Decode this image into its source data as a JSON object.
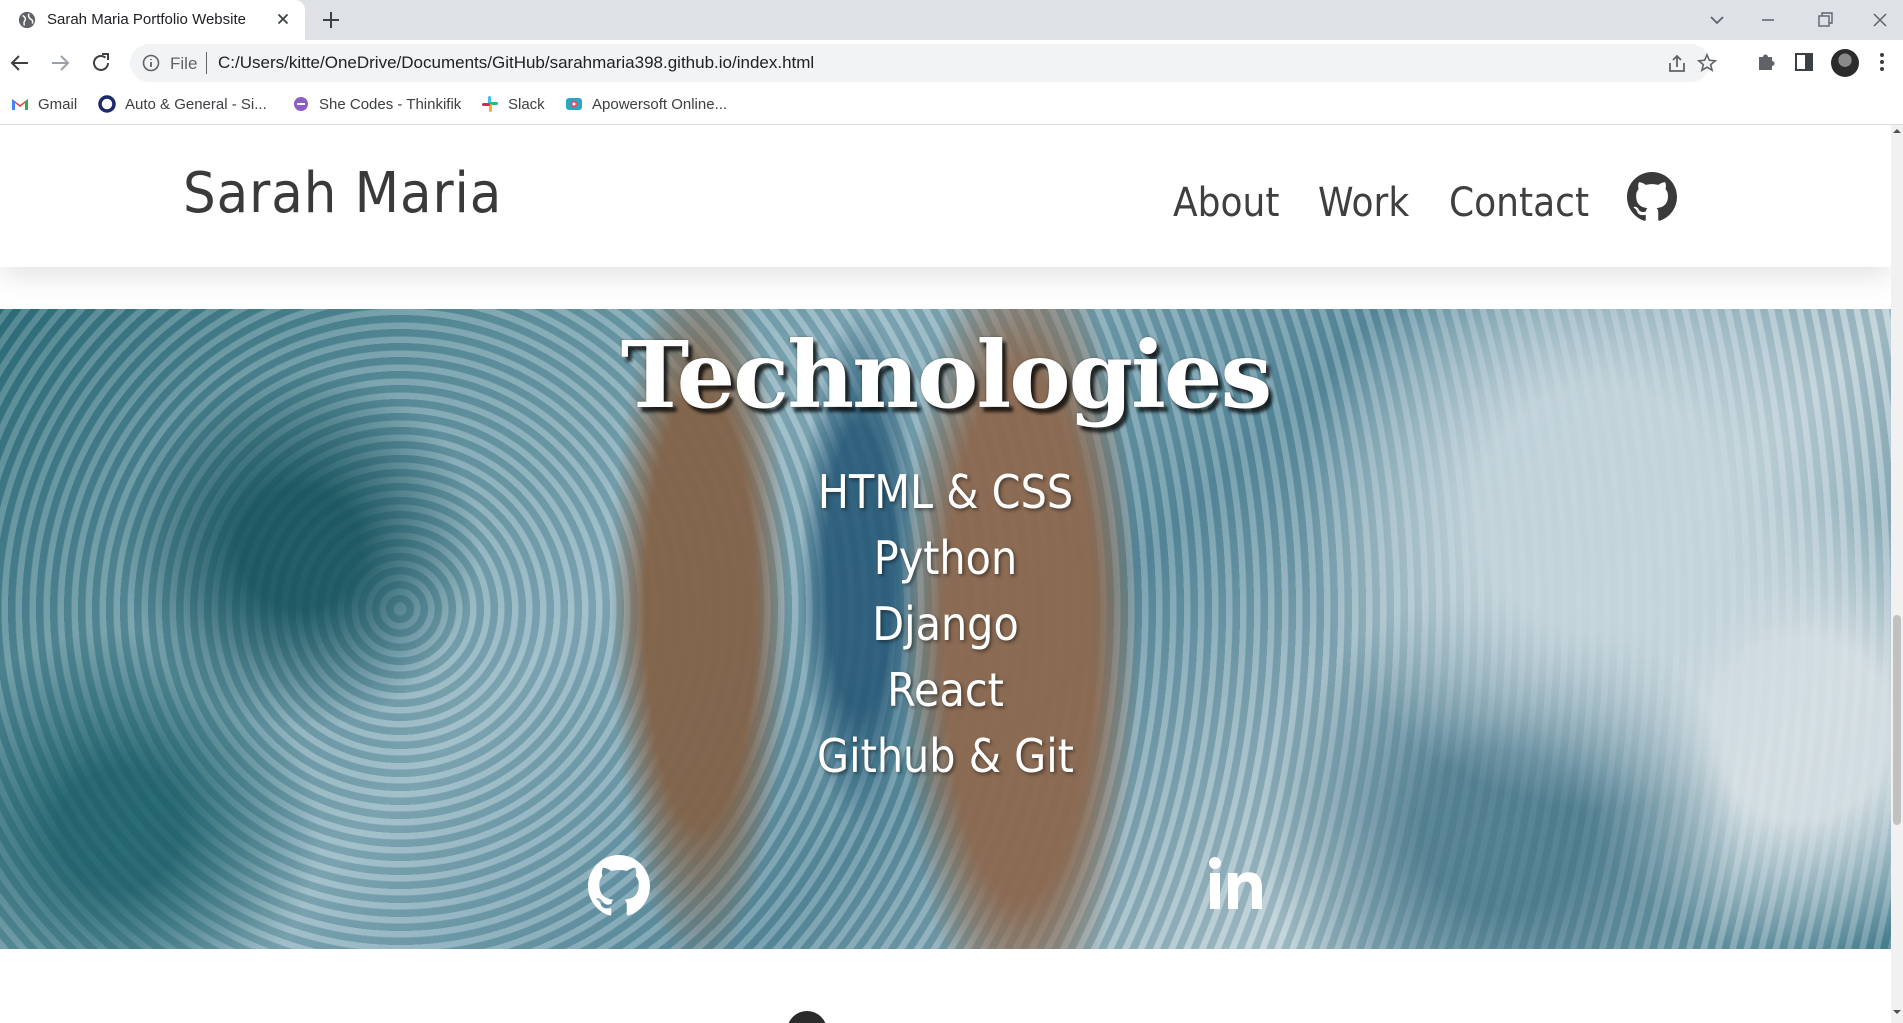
{
  "browser": {
    "tab_title": "Sarah Maria Portfolio Website",
    "omnibox": {
      "scheme_label": "File",
      "url": "C:/Users/kitte/OneDrive/Documents/GitHub/sarahmaria398.github.io/index.html"
    },
    "bookmarks": [
      {
        "label": "Gmail",
        "icon": "gmail-icon"
      },
      {
        "label": "Auto & General - Si...",
        "icon": "ring-icon"
      },
      {
        "label": "She Codes - Thinkifik",
        "icon": "shecodes-icon"
      },
      {
        "label": "Slack",
        "icon": "slack-icon"
      },
      {
        "label": "Apowersoft Online...",
        "icon": "apowersoft-icon"
      }
    ]
  },
  "site": {
    "brand": "Sarah Maria",
    "nav": {
      "about": "About",
      "work": "Work",
      "contact": "Contact"
    }
  },
  "technologies": {
    "title": "Technologies",
    "items": [
      "HTML & CSS",
      "Python",
      "Django",
      "React",
      "Github & Git"
    ]
  },
  "colors": {
    "tabstrip": "#dee1e6",
    "text_dark": "#3a3a3a",
    "hero_text": "#ffffff"
  }
}
